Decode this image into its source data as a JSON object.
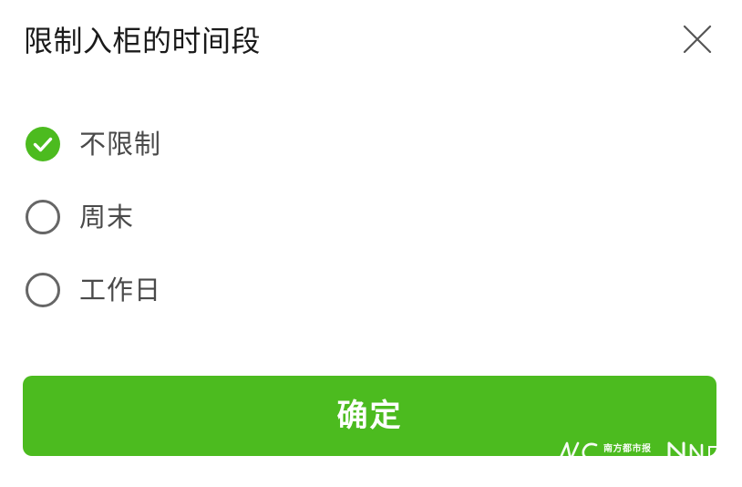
{
  "dialog": {
    "title": "限制入柜的时间段",
    "close_icon": "close-icon"
  },
  "options": [
    {
      "label": "不限制",
      "selected": true
    },
    {
      "label": "周末",
      "selected": false
    },
    {
      "label": "工作日",
      "selected": false
    }
  ],
  "confirm": {
    "label": "确定"
  },
  "watermark": {
    "paper": "南方都市报"
  },
  "colors": {
    "accent": "#4cbb1f",
    "title_text": "#1a1a1a",
    "option_text": "#4a4a4a",
    "radio_border": "#666666",
    "background": "#ffffff"
  }
}
